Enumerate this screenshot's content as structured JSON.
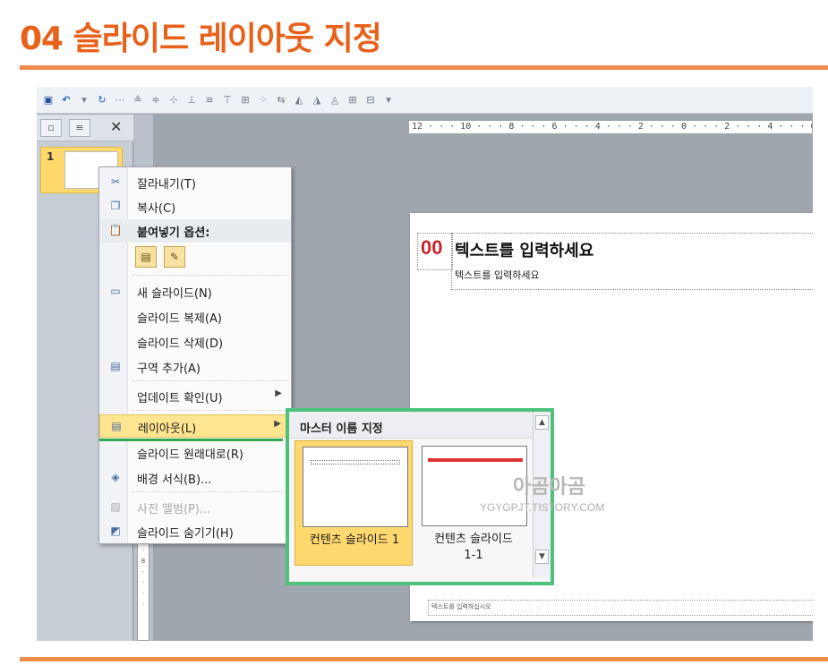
{
  "heading": "04 슬라이드 레이아웃 지정",
  "qat": {
    "icons": [
      "save-icon",
      "undo-icon",
      "redo-icon",
      "layout-tools-icon"
    ]
  },
  "pane": {
    "slide_number": "1"
  },
  "ruler": {
    "horizontal": "12 · · · 10 · · · 8 · · · 6 · · · 4 · · · 2 · · · 0 · · · 2 · · · 4 · · · 6"
  },
  "slide": {
    "number_placeholder": "00",
    "title_placeholder": "텍스트를 입력하세요",
    "subtitle_placeholder": "텍스트를 입력하세요",
    "footer_placeholder": "텍스트를 입력하십시오"
  },
  "context_menu": {
    "cut": "잘라내기(T)",
    "copy": "복사(C)",
    "paste_options": "붙여넣기 옵션:",
    "new_slide": "새 슬라이드(N)",
    "duplicate": "슬라이드 복제(A)",
    "delete": "슬라이드 삭제(D)",
    "add_section": "구역 추가(A)",
    "check_updates": "업데이트 확인(U)",
    "layout": "레이아웃(L)",
    "reset_slide": "슬라이드 원래대로(R)",
    "format_background": "배경 서식(B)...",
    "photo_album": "사진 앨범(P)...",
    "hide_slide": "슬라이드 숨기기(H)"
  },
  "layout_gallery": {
    "header": "마스터 이름 지정",
    "tiles": [
      {
        "label": "컨텐츠 슬라이드 1",
        "selected": true
      },
      {
        "label": "컨텐츠 슬라이드 1-1",
        "selected": false
      }
    ]
  },
  "watermark": {
    "title": "아곰아곰",
    "url": "YGYGPJT.TISTORY.COM"
  },
  "colors": {
    "heading": "#e8611a",
    "rule": "#f08c4a",
    "highlight": "#ffd970",
    "callout_border": "#4ec27a",
    "slide_number": "#c8262e"
  }
}
